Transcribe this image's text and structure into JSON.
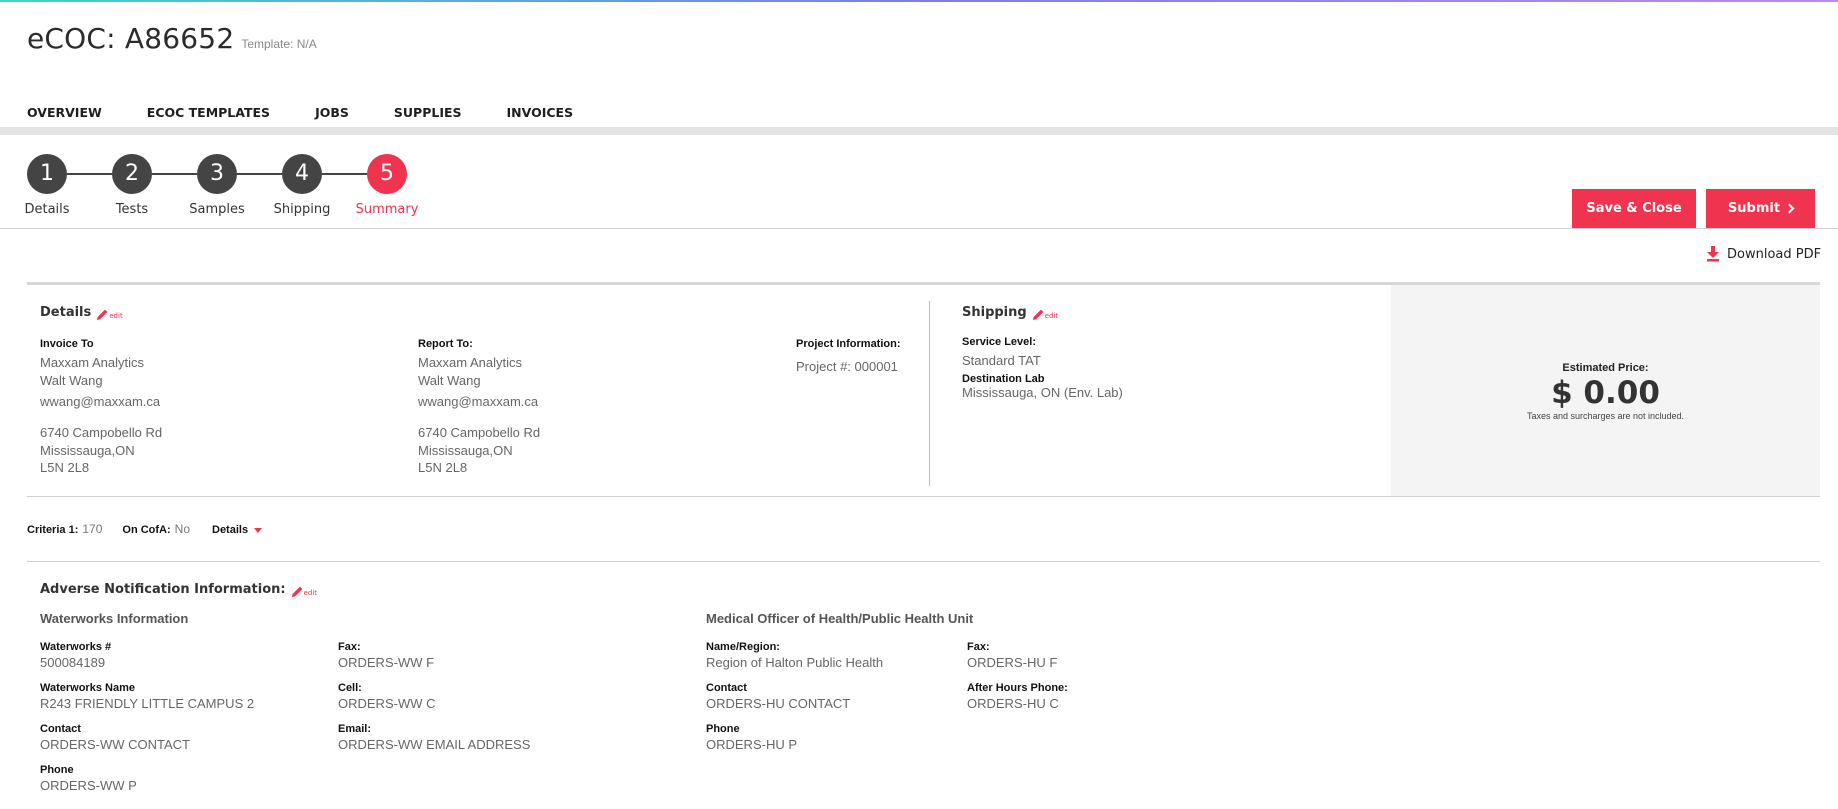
{
  "header": {
    "title": "eCOC: A86652",
    "template": "Template: N/A"
  },
  "nav": {
    "items": [
      "OVERVIEW",
      "ECOC TEMPLATES",
      "JOBS",
      "SUPPLIES",
      "INVOICES"
    ]
  },
  "steps": [
    {
      "num": "1",
      "label": "Details"
    },
    {
      "num": "2",
      "label": "Tests"
    },
    {
      "num": "3",
      "label": "Samples"
    },
    {
      "num": "4",
      "label": "Shipping"
    },
    {
      "num": "5",
      "label": "Summary",
      "active": true
    }
  ],
  "actions": {
    "save_close": "Save & Close",
    "submit": "Submit",
    "download_pdf": "Download PDF"
  },
  "edit_label": "edit",
  "details": {
    "title": "Details",
    "invoice_to": {
      "label": "Invoice To",
      "company": "Maxxam Analytics",
      "name": "Walt Wang",
      "email": "wwang@maxxam.ca",
      "street": "6740 Campobello Rd",
      "city": "Mississauga,ON",
      "postal": "L5N 2L8"
    },
    "report_to": {
      "label": "Report To:",
      "company": "Maxxam Analytics",
      "name": "Walt Wang",
      "email": "wwang@maxxam.ca",
      "street": "6740 Campobello Rd",
      "city": "Mississauga,ON",
      "postal": "L5N 2L8"
    },
    "project": {
      "label": "Project Information:",
      "number": "Project #: 000001"
    }
  },
  "shipping": {
    "title": "Shipping",
    "service_level_label": "Service Level:",
    "service_level": "Standard TAT",
    "destination_label": "Destination Lab",
    "destination": "Mississauga, ON (Env. Lab)"
  },
  "price": {
    "label": "Estimated Price:",
    "value": "$ 0.00",
    "note": "Taxes and surcharges are not included."
  },
  "criteria": {
    "criteria_label": "Criteria 1:",
    "criteria_value": "170",
    "cofa_label": "On CofA:",
    "cofa_value": "No",
    "details_toggle": "Details"
  },
  "adverse": {
    "title": "Adverse Notification Information:",
    "waterworks": {
      "title": "Waterworks Information",
      "number_label": "Waterworks #",
      "number": "500084189",
      "name_label": "Waterworks Name",
      "name": "R243 FRIENDLY LITTLE CAMPUS 2",
      "contact_label": "Contact",
      "contact": "ORDERS-WW CONTACT",
      "phone_label": "Phone",
      "phone": "ORDERS-WW P",
      "fax_label": "Fax:",
      "fax": "ORDERS-WW F",
      "cell_label": "Cell:",
      "cell": "ORDERS-WW C",
      "email_label": "Email:",
      "email": "ORDERS-WW EMAIL ADDRESS"
    },
    "medical": {
      "title": "Medical Officer of Health/Public Health Unit",
      "region_label": "Name/Region:",
      "region": "Region of Halton Public Health",
      "contact_label": "Contact",
      "contact": "ORDERS-HU CONTACT",
      "phone_label": "Phone",
      "phone": "ORDERS-HU P",
      "fax_label": "Fax:",
      "fax": "ORDERS-HU F",
      "after_hours_label": "After Hours Phone:",
      "after_hours": "ORDERS-HU C"
    }
  },
  "colors": {
    "accent": "#f0334f",
    "step_dark": "#444444"
  }
}
